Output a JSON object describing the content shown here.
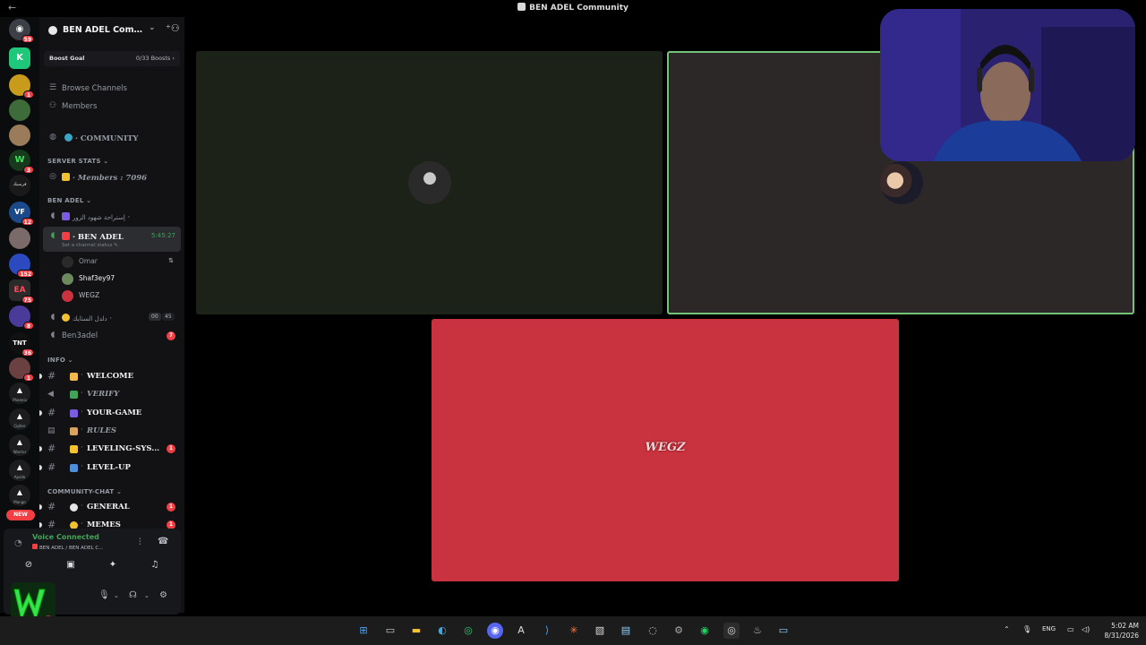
{
  "window": {
    "title": "BEN ADEL Community"
  },
  "server": {
    "name": "BEN ADEL Community",
    "boost_label": "Boost Goal",
    "boost_value": "0/33 Boosts"
  },
  "rail": {
    "badges": [
      "59",
      "1",
      "3",
      "12",
      "152",
      "75",
      "8",
      "36",
      "1"
    ],
    "captions": [
      "فرسيك",
      "Phoenix",
      "Cipher",
      "Warrior",
      "Apollo",
      "Mango"
    ],
    "new_label": "NEW"
  },
  "nav": {
    "browse_channels": "Browse Channels",
    "members": "Members",
    "community": "COMMUNITY"
  },
  "categories": {
    "server_stats": "SERVER STATS",
    "ben_adel": "BEN ADEL",
    "info": "INFO",
    "community_chat": "COMMUNITY-CHAT"
  },
  "channels": {
    "members_stat": "Members : 7096",
    "voice_1": "إستراحة شهود الزور",
    "active_voice": "BEN ADEL",
    "active_voice_timer": "5:45:27",
    "set_status": "Set a channel status",
    "voice_users": [
      "Omar",
      "Shaf3ey97",
      "WEGZ"
    ],
    "voice_2": "دلدل الستايك",
    "voice_2_counts": [
      "00",
      "45"
    ],
    "voice_3": "Ben3adel",
    "voice_3_badge": "7",
    "text": [
      {
        "name": "WELCOME",
        "badge": ""
      },
      {
        "name": "VERIFY",
        "badge": ""
      },
      {
        "name": "YOUR-GAME",
        "badge": ""
      },
      {
        "name": "RULES",
        "badge": ""
      },
      {
        "name": "LEVELING-SYS...",
        "badge": "1"
      },
      {
        "name": "LEVEL-UP",
        "badge": ""
      }
    ],
    "chat": [
      {
        "name": "GENERAL",
        "badge": "1"
      },
      {
        "name": "MEMES",
        "badge": "1"
      }
    ]
  },
  "voice_panel": {
    "status": "Voice Connected",
    "location": "BEN ADEL / BEN ADEL C..."
  },
  "stage": {
    "tile_label": "WEGZ"
  },
  "taskbar": {
    "lang": "ENG",
    "time": "5:02 AM",
    "date": "8/31/2026"
  },
  "colors": {
    "accent_green": "#43a25a",
    "badge_red": "#f23f43",
    "tile_red": "#c9323f",
    "speaking_border": "#76c47a"
  }
}
